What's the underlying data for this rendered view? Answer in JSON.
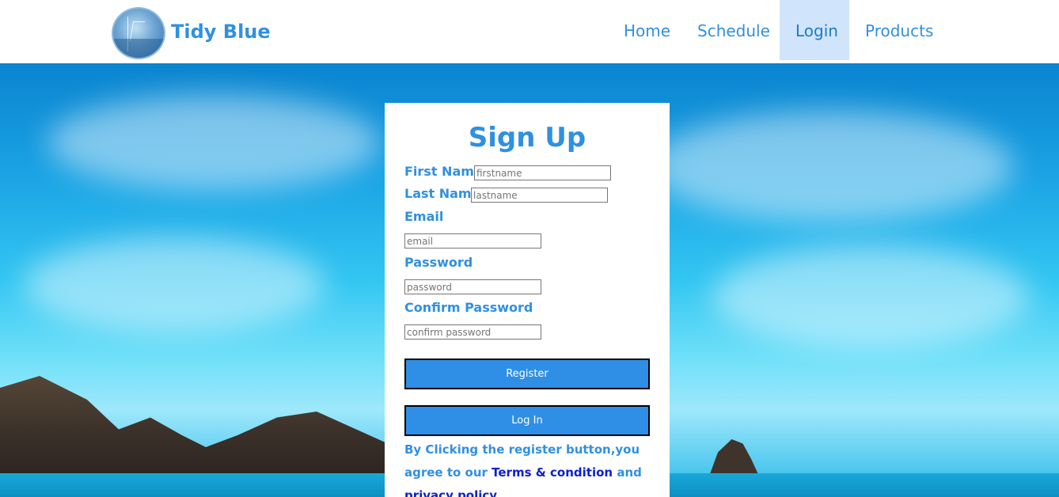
{
  "header": {
    "brand": "Tidy Blue",
    "nav": [
      {
        "label": "Home",
        "active": false
      },
      {
        "label": "Schedule",
        "active": false
      },
      {
        "label": "Login",
        "active": true
      },
      {
        "label": "Products",
        "active": false
      }
    ]
  },
  "form": {
    "title": "Sign Up",
    "first_name": {
      "label": "First Name",
      "placeholder": "firstname",
      "value": ""
    },
    "last_name": {
      "label": "Last Name",
      "placeholder": "lastname",
      "value": ""
    },
    "email": {
      "label": "Email",
      "placeholder": "email",
      "value": ""
    },
    "password": {
      "label": "Password",
      "placeholder": "password",
      "value": ""
    },
    "confirm_password": {
      "label": "Confirm Password",
      "placeholder": "confirm password",
      "value": ""
    },
    "register_label": "Register",
    "login_label": "Log In",
    "agreement_text": "By Clicking the register button,you agree to our",
    "terms_link": "Terms & condition",
    "and_text": "and",
    "privacy_link": "privacy policy"
  },
  "colors": {
    "brand_blue": "#3090e0",
    "button_blue": "#2f8fe6",
    "active_nav_bg": "#d0e4fb",
    "link_dark_blue": "#0a1fcc"
  },
  "icons": {
    "logo": "tidy-blue-logo"
  }
}
